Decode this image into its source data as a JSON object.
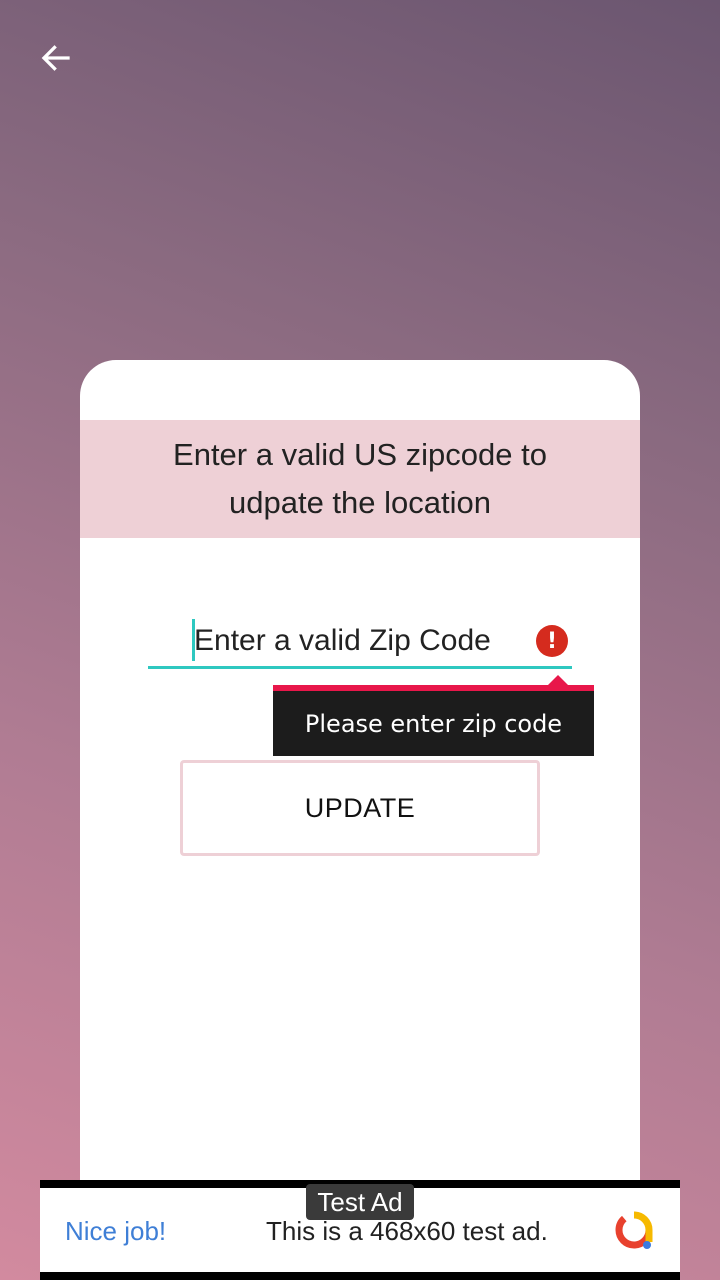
{
  "header": {
    "back_icon": "arrow-left-icon"
  },
  "card": {
    "title": "Enter a valid US zipcode to udpate the location",
    "zip_placeholder": "Enter a valid Zip Code",
    "error_icon": "error-exclamation-icon",
    "error_message": "Please enter zip code",
    "update_label": "UPDATE"
  },
  "ad": {
    "label": "Test Ad",
    "nice": "Nice job!",
    "text": "This is a 468x60 test ad.",
    "logo_icon": "ad-logo-icon"
  },
  "colors": {
    "accent": "#2ec8c0",
    "error": "#d52b1e",
    "header_bg": "#eed0d6"
  }
}
